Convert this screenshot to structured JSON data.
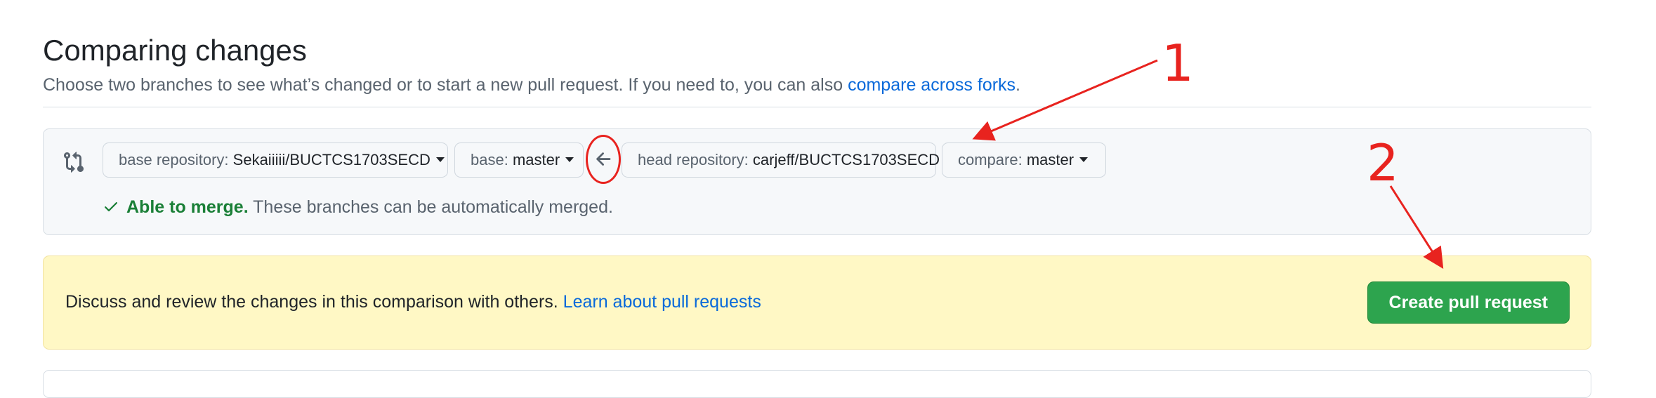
{
  "page": {
    "title": "Comparing changes",
    "subtitle_text": "Choose two branches to see what’s changed or to start a new pull request. If you need to, you can also ",
    "subtitle_link": "compare across forks",
    "subtitle_end": "."
  },
  "range": {
    "base_repo_label": "base repository:",
    "base_repo_value": "Sekaiiiii/BUCTCS1703SECD",
    "base_label": "base:",
    "base_value": "master",
    "head_repo_label": "head repository:",
    "head_repo_value": "carjeff/BUCTCS1703SECD",
    "compare_label": "compare:",
    "compare_value": "master"
  },
  "merge": {
    "status": "Able to merge.",
    "detail": " These branches can be automatically merged."
  },
  "flash": {
    "text": "Discuss and review the changes in this comparison with others. ",
    "link": "Learn about pull requests",
    "button": "Create pull request"
  },
  "annotations": {
    "one": "1",
    "two": "2",
    "color": "#e8231f"
  },
  "icons": {
    "compare": "git-compare-icon",
    "arrow": "arrow-left-icon",
    "check": "check-icon",
    "caret": "caret-down-icon"
  },
  "colors": {
    "link": "#0969da",
    "success": "#1a7f37",
    "button": "#2da44e",
    "flash_bg": "#fff8c5"
  }
}
